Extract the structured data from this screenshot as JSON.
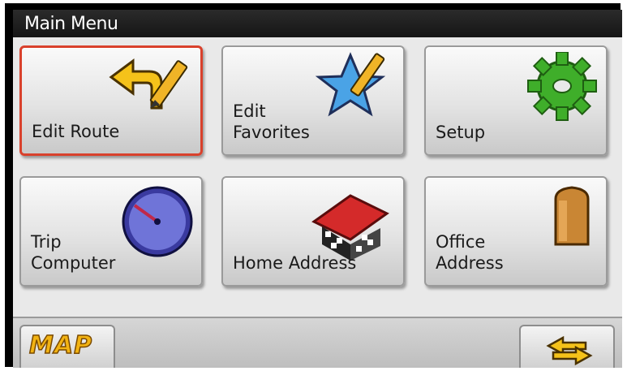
{
  "title": "Main Menu",
  "tiles": [
    {
      "label": "Edit Route",
      "icon": "route-arrow-pencil-icon"
    },
    {
      "label": "Edit\nFavorites",
      "icon": "star-pencil-icon"
    },
    {
      "label": "Setup",
      "icon": "gear-icon"
    },
    {
      "label": "Trip\nComputer",
      "icon": "speedometer-icon"
    },
    {
      "label": "Home Address",
      "icon": "house-icon"
    },
    {
      "label": "Office\nAddress",
      "icon": "building-icon"
    }
  ],
  "bottom": {
    "map_label": "MAP",
    "back_icon": "back-arrows-icon"
  },
  "colors": {
    "selected_border": "#d9412c",
    "accent_yellow": "#f2b313"
  }
}
